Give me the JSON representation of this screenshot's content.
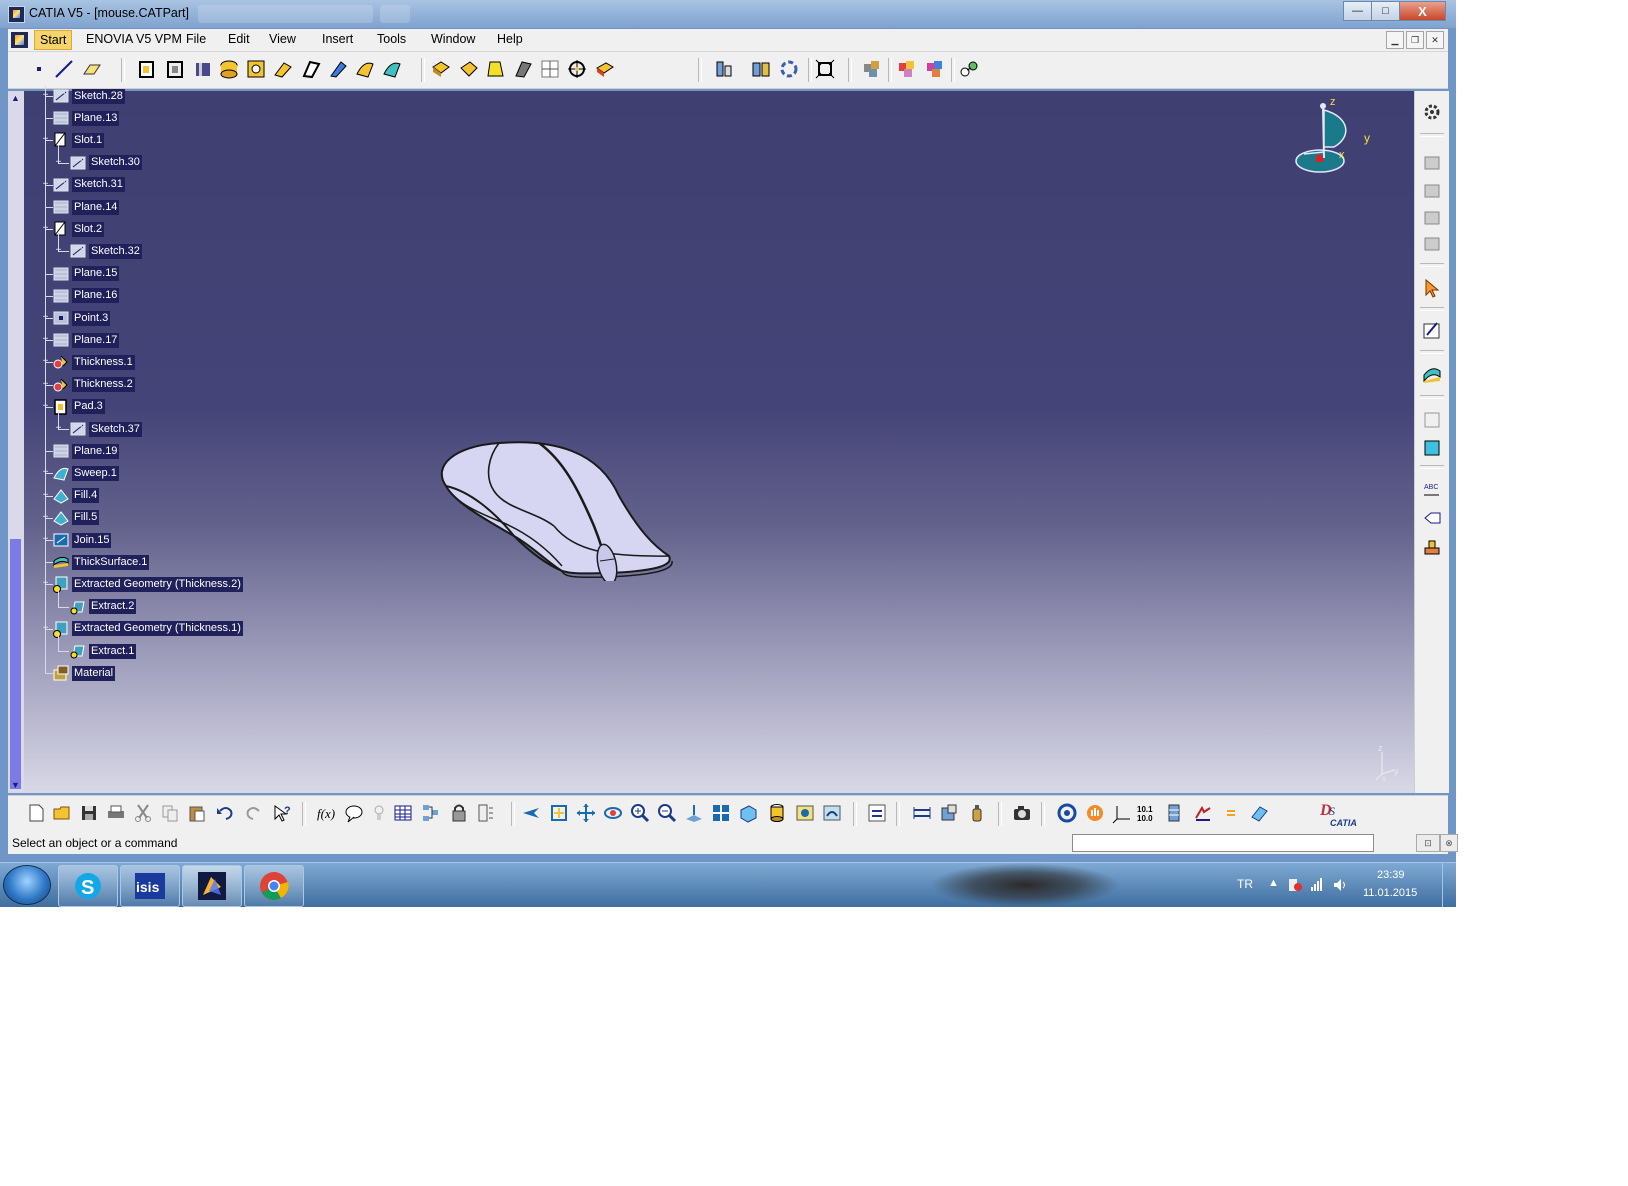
{
  "window": {
    "title": "CATIA V5 - [mouse.CATPart]",
    "controls": {
      "minimize": "—",
      "maximize": "□",
      "close": "X"
    }
  },
  "menu": {
    "items": [
      "Start",
      "ENOVIA V5 VPM",
      "File",
      "Edit",
      "View",
      "Insert",
      "Tools",
      "Window",
      "Help"
    ],
    "active": "Start"
  },
  "tree": {
    "nodes": [
      {
        "label": "Sketch.28",
        "icon": "sketch-icon"
      },
      {
        "label": "Plane.13",
        "icon": "plane-icon"
      },
      {
        "label": "Slot.1",
        "icon": "slot-icon"
      },
      {
        "label": "Sketch.30",
        "icon": "sketch-icon"
      },
      {
        "label": "Sketch.31",
        "icon": "sketch-icon"
      },
      {
        "label": "Plane.14",
        "icon": "plane-icon"
      },
      {
        "label": "Slot.2",
        "icon": "slot-icon"
      },
      {
        "label": "Sketch.32",
        "icon": "sketch-icon"
      },
      {
        "label": "Plane.15",
        "icon": "plane-icon"
      },
      {
        "label": "Plane.16",
        "icon": "plane-icon"
      },
      {
        "label": "Point.3",
        "icon": "point-icon"
      },
      {
        "label": "Plane.17",
        "icon": "plane-icon"
      },
      {
        "label": "Thickness.1",
        "icon": "thickness-icon"
      },
      {
        "label": "Thickness.2",
        "icon": "thickness-icon"
      },
      {
        "label": "Pad.3",
        "icon": "pad-icon"
      },
      {
        "label": "Sketch.37",
        "icon": "sketch-icon"
      },
      {
        "label": "Plane.19",
        "icon": "plane-icon"
      },
      {
        "label": "Sweep.1",
        "icon": "sweep-icon"
      },
      {
        "label": "Fill.4",
        "icon": "fill-icon"
      },
      {
        "label": "Fill.5",
        "icon": "fill-icon"
      },
      {
        "label": "Join.15",
        "icon": "join-icon"
      },
      {
        "label": "ThickSurface.1",
        "icon": "thick-surface-icon"
      },
      {
        "label": "Extracted Geometry (Thickness.2)",
        "icon": "extracted-geometry-icon"
      },
      {
        "label": "Extract.2",
        "icon": "extract-icon"
      },
      {
        "label": "Extracted Geometry (Thickness.1)",
        "icon": "extracted-geometry-icon"
      },
      {
        "label": "Extract.1",
        "icon": "extract-icon"
      },
      {
        "label": "Material",
        "icon": "material-icon"
      }
    ]
  },
  "compass": {
    "x": "x",
    "y": "y",
    "z": "z"
  },
  "mini_axis": {
    "z": "z",
    "x": "x",
    "y": "y"
  },
  "status": {
    "message": "Select an object or a command",
    "command_input": ""
  },
  "brand": {
    "logo_text": "CATIA"
  },
  "taskbar": {
    "language": "TR",
    "time": "23:39",
    "date": "11.01.2015",
    "apps": [
      "skype-icon",
      "isis-icon",
      "catia-icon",
      "chrome-icon"
    ],
    "isis_label": "isis"
  },
  "colors": {
    "viewport_top": "#3f3f71",
    "viewport_bottom": "#d8d8e6",
    "tree_text": "#ffffff",
    "model_fill": "#d9d8f4"
  }
}
